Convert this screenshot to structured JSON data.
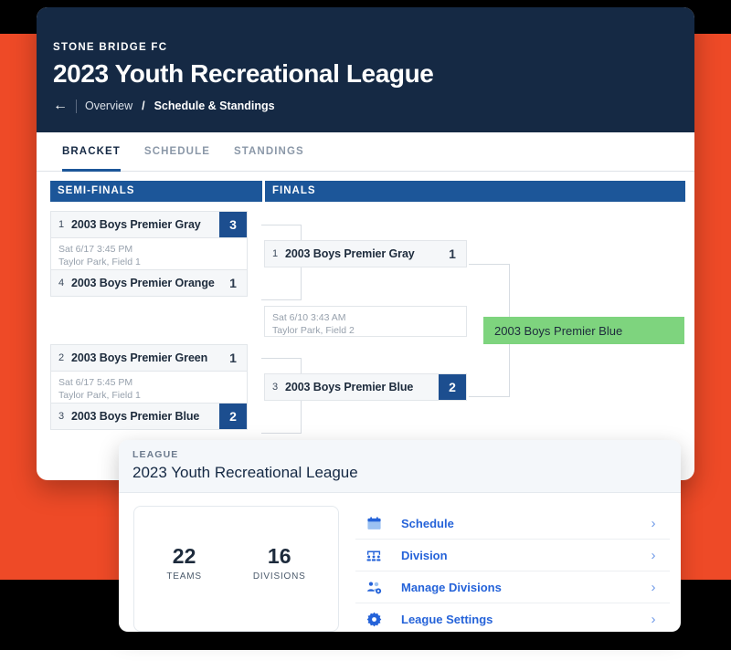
{
  "background": {
    "accent_orange": "#ee4a27",
    "black": "#000000",
    "white": "#ffffff"
  },
  "header": {
    "org_name": "STONE BRIDGE FC",
    "title": "2023 Youth Recreational League",
    "back_arrow": "←",
    "breadcrumb_parent": "Overview",
    "breadcrumb_separator": "/",
    "breadcrumb_current": "Schedule & Standings",
    "bg_color": "#152944"
  },
  "tabs": [
    {
      "label": "BRACKET",
      "active": true
    },
    {
      "label": "SCHEDULE",
      "active": false
    },
    {
      "label": "STANDINGS",
      "active": false
    }
  ],
  "bracket": {
    "round_headers": [
      {
        "label": "SEMI-FINALS"
      },
      {
        "label": "FINALS"
      }
    ],
    "header_bg": "#1c5699",
    "winner_score_bg": "#1c4e8f",
    "champion_bg": "#7ed47e",
    "semifinals": [
      {
        "top": {
          "seed": "1",
          "team": "2003 Boys Premier Gray",
          "score": "3",
          "winner": true
        },
        "info": {
          "datetime": "Sat 6/17 3:45 PM",
          "location": "Taylor Park, Field 1"
        },
        "bottom": {
          "seed": "4",
          "team": "2003 Boys Premier Orange",
          "score": "1",
          "winner": false
        }
      },
      {
        "top": {
          "seed": "2",
          "team": "2003 Boys Premier Green",
          "score": "1",
          "winner": false
        },
        "info": {
          "datetime": "Sat 6/17 5:45 PM",
          "location": "Taylor Park, Field 1"
        },
        "bottom": {
          "seed": "3",
          "team": "2003 Boys Premier Blue",
          "score": "2",
          "winner": true
        }
      }
    ],
    "finals": {
      "top": {
        "seed": "1",
        "team": "2003 Boys Premier Gray",
        "score": "1",
        "winner": false
      },
      "info": {
        "datetime": "Sat 6/10 3:43 AM",
        "location": "Taylor Park, Field 2"
      },
      "bottom": {
        "seed": "3",
        "team": "2003 Boys Premier Blue",
        "score": "2",
        "winner": true
      }
    },
    "champion": {
      "team": "2003 Boys Premier Blue"
    }
  },
  "league_card": {
    "label": "LEAGUE",
    "name": "2023 Youth Recreational League",
    "stats": [
      {
        "value": "22",
        "label": "TEAMS"
      },
      {
        "value": "16",
        "label": "DIVISIONS"
      }
    ],
    "menu": [
      {
        "label": "Schedule",
        "icon": "calendar-icon",
        "chevron": "›"
      },
      {
        "label": "Division",
        "icon": "division-group-icon",
        "chevron": "›"
      },
      {
        "label": "Manage Divisions",
        "icon": "manage-divisions-icon",
        "chevron": "›"
      },
      {
        "label": "League Settings",
        "icon": "gear-icon",
        "chevron": "›"
      }
    ],
    "link_color": "#2563d9"
  }
}
